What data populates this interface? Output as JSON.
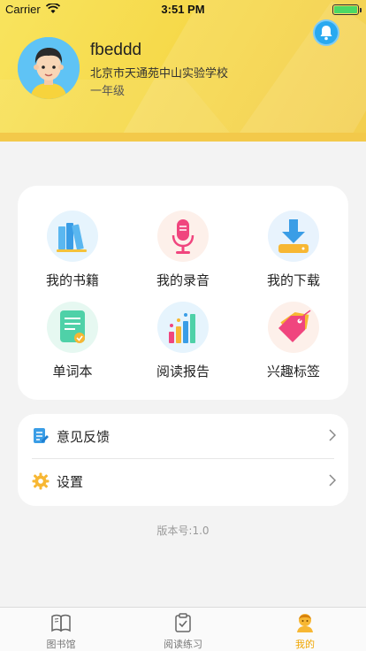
{
  "status_bar": {
    "carrier": "Carrier",
    "time": "3:51 PM"
  },
  "profile": {
    "username": "fbeddd",
    "school": "北京市天通苑中山实验学校",
    "grade": "一年级"
  },
  "grid": {
    "items": [
      {
        "label": "我的书籍",
        "icon": "books-icon"
      },
      {
        "label": "我的录音",
        "icon": "microphone-icon"
      },
      {
        "label": "我的下载",
        "icon": "download-icon"
      },
      {
        "label": "单词本",
        "icon": "notebook-icon"
      },
      {
        "label": "阅读报告",
        "icon": "bar-chart-icon"
      },
      {
        "label": "兴趣标签",
        "icon": "tag-icon"
      }
    ]
  },
  "list": {
    "items": [
      {
        "label": "意见反馈",
        "icon": "feedback-icon"
      },
      {
        "label": "设置",
        "icon": "gear-icon"
      }
    ]
  },
  "version": "版本号:1.0",
  "tabbar": {
    "tabs": [
      {
        "label": "图书馆",
        "icon": "library-icon",
        "active": false
      },
      {
        "label": "阅读练习",
        "icon": "clipboard-check-icon",
        "active": false
      },
      {
        "label": "我的",
        "icon": "profile-icon",
        "active": true
      }
    ]
  },
  "colors": {
    "accent": "#f0a500",
    "header": "#f6d94a",
    "bell": "#29a9f0"
  }
}
